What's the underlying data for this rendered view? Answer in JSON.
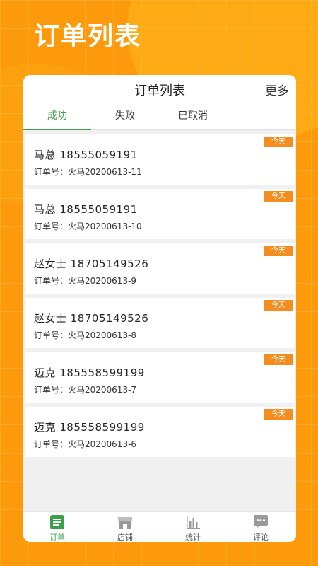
{
  "hero": {
    "title": "订单列表"
  },
  "header": {
    "title": "订单列表",
    "more_label": "更多"
  },
  "tabs": [
    {
      "label": "成功",
      "active": true
    },
    {
      "label": "失败",
      "active": false
    },
    {
      "label": "已取消",
      "active": false
    }
  ],
  "orders": [
    {
      "badge": "今天",
      "name": "马总  18555059191",
      "order_no": "订单号：火马20200613-11"
    },
    {
      "badge": "今天",
      "name": "马总  18555059191",
      "order_no": "订单号：火马20200613-10"
    },
    {
      "badge": "今天",
      "name": "赵女士  18705149526",
      "order_no": "订单号：火马20200613-9"
    },
    {
      "badge": "今天",
      "name": "赵女士  18705149526",
      "order_no": "订单号：火马20200613-8"
    },
    {
      "badge": "今天",
      "name": "迈克  185558599199",
      "order_no": "订单号：火马20200613-7"
    },
    {
      "badge": "今天",
      "name": "迈克  185558599199",
      "order_no": "订单号：火马20200613-6"
    }
  ],
  "tabbar": [
    {
      "label": "订单",
      "icon": "order-list-icon",
      "active": true
    },
    {
      "label": "店铺",
      "icon": "store-icon",
      "active": false
    },
    {
      "label": "统计",
      "icon": "bar-chart-icon",
      "active": false
    },
    {
      "label": "评论",
      "icon": "comment-icon",
      "active": false
    }
  ],
  "colors": {
    "background": "#fd9a0c",
    "accent_green": "#3aa14a",
    "badge_orange": "#f58d1e"
  }
}
